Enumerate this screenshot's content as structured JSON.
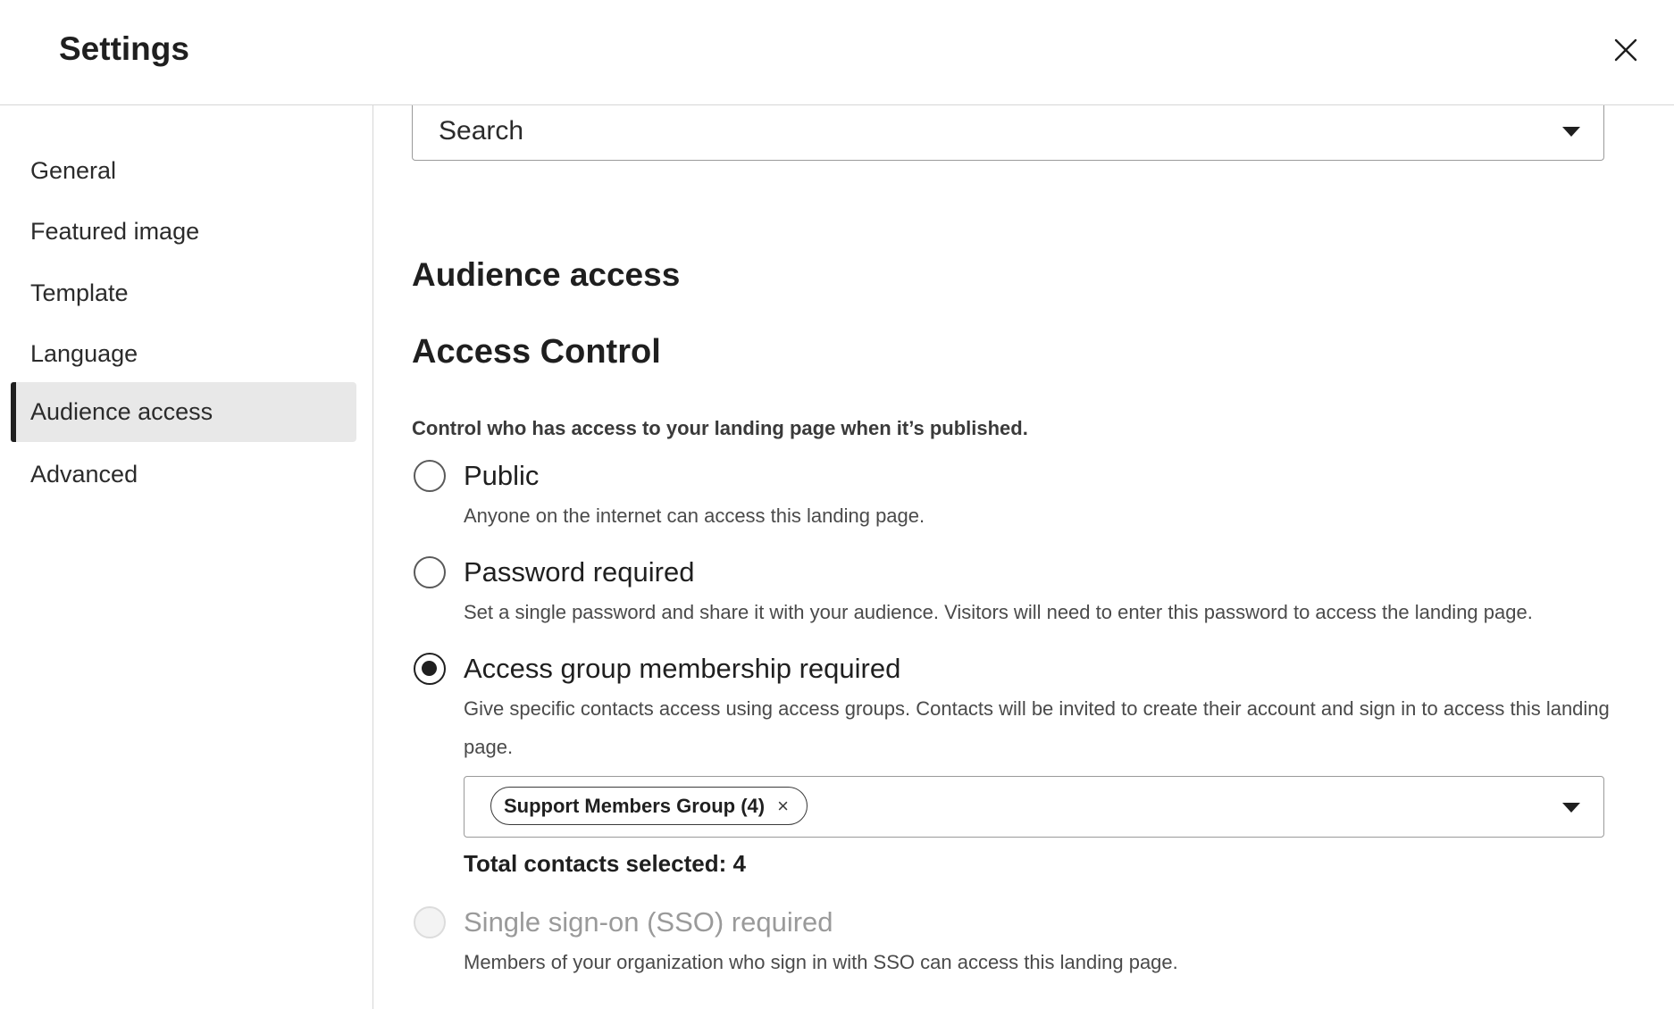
{
  "header": {
    "title": "Settings",
    "close_icon": "close-icon"
  },
  "sidebar": {
    "items": [
      {
        "label": "General",
        "active": false
      },
      {
        "label": "Featured image",
        "active": false
      },
      {
        "label": "Template",
        "active": false
      },
      {
        "label": "Language",
        "active": false
      },
      {
        "label": "Audience access",
        "active": true
      },
      {
        "label": "Advanced",
        "active": false
      }
    ]
  },
  "main": {
    "search_select": {
      "value": "Search"
    },
    "audience_heading": "Audience access",
    "access_control_heading": "Access Control",
    "access_description": "Control who has access to your landing page when it’s published.",
    "options": [
      {
        "label": "Public",
        "help": "Anyone on the internet can access this landing page.",
        "checked": false,
        "disabled": false
      },
      {
        "label": "Password required",
        "help": "Set a single password and share it with your audience. Visitors will need to enter this password to access the landing page.",
        "checked": false,
        "disabled": false
      },
      {
        "label": "Access group membership required",
        "help": "Give specific contacts access using access groups. Contacts will be invited to create their account and sign in to access this landing page.",
        "checked": true,
        "disabled": false
      },
      {
        "label": "Single sign-on (SSO) required",
        "help": "Members of your organization who sign in with SSO can access this landing page.",
        "checked": false,
        "disabled": true
      }
    ],
    "group_select": {
      "chips": [
        {
          "label": "Support Members Group (4)",
          "remove": "×"
        }
      ]
    },
    "total_selected": "Total contacts selected: 4"
  },
  "colors": {
    "text": "#1f1f1f",
    "border": "#9a9a9a",
    "active_nav_bg": "#e8e8e8",
    "disabled_text": "#9a9a9a"
  }
}
